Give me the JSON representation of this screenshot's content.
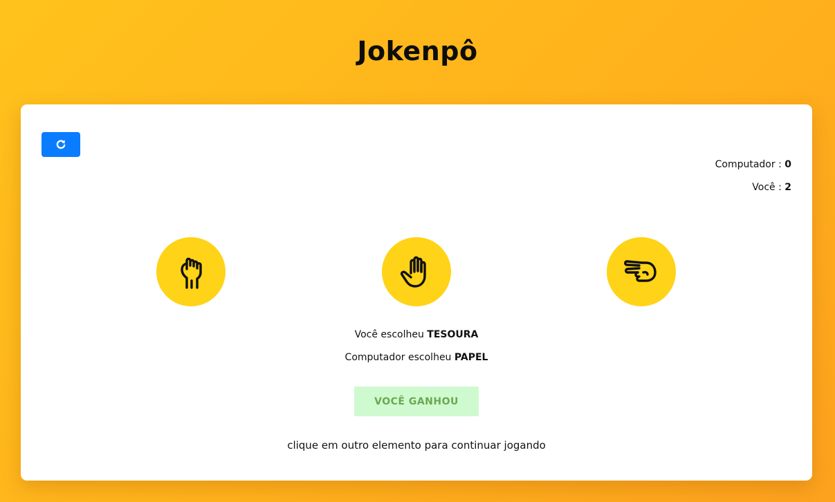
{
  "title": "Jokenpô",
  "score": {
    "computer_label": "Computador : ",
    "computer_value": "0",
    "you_label": "Você : ",
    "you_value": "2"
  },
  "choices": [
    {
      "name": "pedra",
      "icon": "fist-icon"
    },
    {
      "name": "papel",
      "icon": "open-hand-icon"
    },
    {
      "name": "tesoura",
      "icon": "scissors-hand-icon"
    }
  ],
  "result": {
    "you_prefix": "Você escolheu ",
    "you_choice": "TESOURA",
    "computer_prefix": "Computador escolheu ",
    "computer_choice": "PAPEL",
    "outcome": "VOCÊ GANHOU"
  },
  "hint": "clique em outro elemento para continuar jogando",
  "colors": {
    "background": "#ffb01c",
    "choice_circle": "#ffd317",
    "reset_button": "#0a7cff",
    "outcome_bg": "#cffacf",
    "outcome_text": "#6aa84f"
  }
}
